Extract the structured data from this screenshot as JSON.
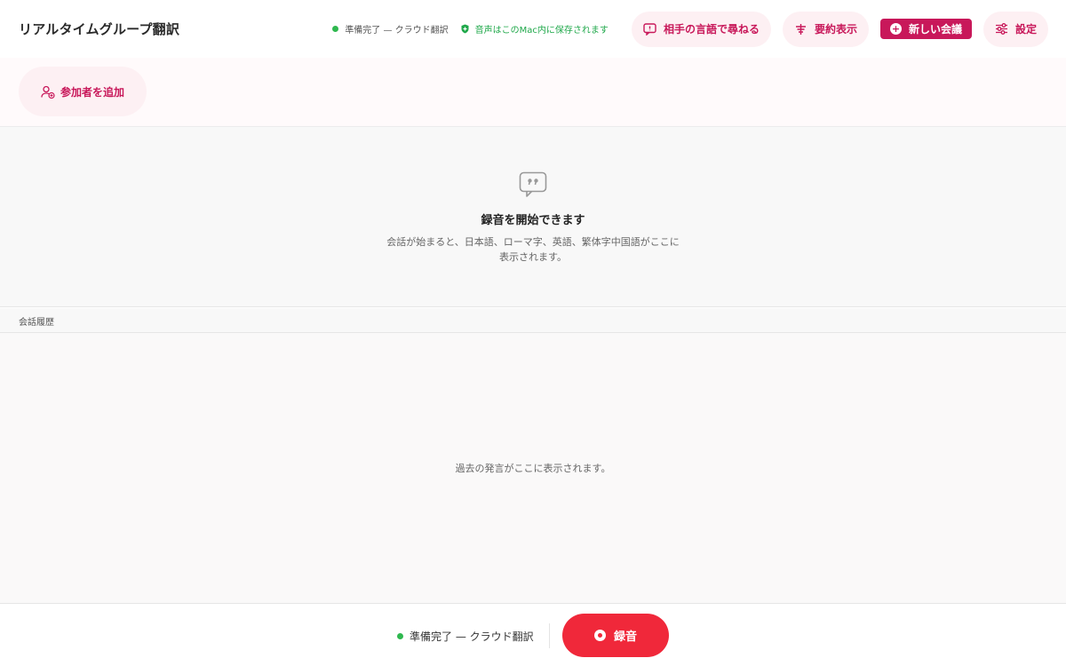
{
  "header": {
    "title": "リアルタイムグループ翻訳",
    "status_text": "準備完了 — クラウド翻訳",
    "status_color": "#2fb84f",
    "privacy_text": "音声はこのMac内に保存されます",
    "ask_language_label": "相手の言語で尋ねる",
    "summary_label": "要約表示",
    "new_meeting_label": "新しい会議",
    "settings_label": "設定",
    "accent_color": "#c8185a"
  },
  "participants": {
    "add_label": "参加者を追加"
  },
  "empty_state": {
    "title": "録音を開始できます",
    "description_line1": "会話が始まると、日本語、ローマ字、英語、繁体字中国語がここに",
    "description_line2": "表示されます。",
    "icon": "quote-bubble-icon"
  },
  "history": {
    "heading": "会話履歴",
    "empty_text": "過去の発言がここに表示されます。"
  },
  "footer": {
    "status_text": "準備完了 — クラウド翻訳",
    "record_label": "録音",
    "record_color": "#f0283a"
  }
}
